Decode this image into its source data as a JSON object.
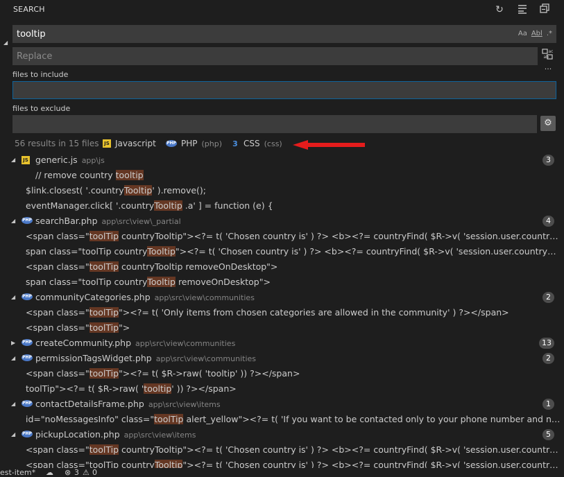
{
  "header": {
    "title": "SEARCH",
    "refresh_icon": "refresh-icon",
    "clear_icon": "clear-results-icon",
    "collapse_icon": "collapse-all-icon"
  },
  "search": {
    "query": "tooltip",
    "opt_case": "Aa",
    "opt_word": "Abl",
    "opt_regex": ".*",
    "replace_placeholder": "Replace",
    "include_label": "files to include",
    "include_value": "",
    "exclude_label": "files to exclude",
    "exclude_value": "",
    "more": "···"
  },
  "summary": {
    "text": "56 results in 15 files",
    "langs": [
      {
        "name": "Javascript",
        "sub": "",
        "badge": "JS"
      },
      {
        "name": "PHP",
        "sub": "(php)",
        "badge": "PHP"
      },
      {
        "name": "CSS",
        "sub": "(css)",
        "badge": "3"
      }
    ]
  },
  "colors": {
    "accent": "#0e639c",
    "highlight": "#653723",
    "arrow": "#e51c1c",
    "js": "#e8c22d",
    "php": "#4a78c7"
  },
  "results": [
    {
      "type": "file",
      "expanded": true,
      "icon": "js",
      "name": "generic.js",
      "path": "app\\js",
      "count": "3"
    },
    {
      "type": "match",
      "indent": 51,
      "pre": "// remove country ",
      "hl": "tooltip",
      "post": ""
    },
    {
      "type": "match",
      "indent": 37,
      "pre": "$link.closest( '.country",
      "hl": "Tooltip",
      "post": "' ).remove();"
    },
    {
      "type": "match",
      "indent": 37,
      "pre": "eventManager.click[ '.country",
      "hl": "Tooltip",
      "post": " .a' ] = function (e) {"
    },
    {
      "type": "file",
      "expanded": true,
      "icon": "php",
      "name": "searchBar.php",
      "path": "app\\src\\view\\_partial",
      "count": "4"
    },
    {
      "type": "match",
      "indent": 37,
      "pre": "<span class=\"",
      "hl": "toolTip",
      "post": " countryTooltip\"><?= t( 'Chosen country is' ) ?> <b><?= countryFind( $R->v( 'session.user.countryAddress', $R->v('sessio"
    },
    {
      "type": "match",
      "indent": 37,
      "pre": "span class=\"toolTip country",
      "hl": "Tooltip",
      "post": "\"><?= t( 'Chosen country is' ) ?> <b><?= countryFind( $R->v( 'session.user.countryAddress', $R->v('session."
    },
    {
      "type": "match",
      "indent": 37,
      "pre": "<span class=\"",
      "hl": "toolTip",
      "post": " countryTooltip removeOnDesktop\">"
    },
    {
      "type": "match",
      "indent": 37,
      "pre": "span class=\"toolTip country",
      "hl": "Tooltip",
      "post": " removeOnDesktop\">"
    },
    {
      "type": "file",
      "expanded": true,
      "icon": "php",
      "name": "communityCategories.php",
      "path": "app\\src\\view\\communities",
      "count": "2"
    },
    {
      "type": "match",
      "indent": 37,
      "pre": "<span class=\"",
      "hl": "toolTip",
      "post": "\"><?= t( 'Only items from chosen categories are allowed in the community' ) ?></span>"
    },
    {
      "type": "match",
      "indent": 37,
      "pre": "<span class=\"",
      "hl": "toolTip",
      "post": "\">"
    },
    {
      "type": "file",
      "expanded": false,
      "icon": "php",
      "name": "createCommunity.php",
      "path": "app\\src\\view\\communities",
      "count": "13"
    },
    {
      "type": "file",
      "expanded": true,
      "icon": "php",
      "name": "permissionTagsWidget.php",
      "path": "app\\src\\view\\communities",
      "count": "2"
    },
    {
      "type": "match",
      "indent": 37,
      "pre": "<span class=\"",
      "hl": "toolTip",
      "post": "\"><?= t( $R->raw( 'tooltip' )) ?></span>"
    },
    {
      "type": "match",
      "indent": 37,
      "pre": "toolTip\"><?= t( $R->raw( '",
      "hl": "tooltip",
      "post": "' )) ?></span>"
    },
    {
      "type": "file",
      "expanded": true,
      "icon": "php",
      "name": "contactDetailsFrame.php",
      "path": "app\\src\\view\\items",
      "count": "1"
    },
    {
      "type": "match",
      "indent": 37,
      "pre": "id=\"noMessagesInfo\" class=\"",
      "hl": "toolTip",
      "post": " alert_yellow\"><?= t( 'If you want to be contacted only to your phone number and not to the messages, plea"
    },
    {
      "type": "file",
      "expanded": true,
      "icon": "php",
      "name": "pickupLocation.php",
      "path": "app\\src\\view\\items",
      "count": "5"
    },
    {
      "type": "match",
      "indent": 37,
      "pre": "<span class=\"",
      "hl": "toolTip",
      "post": " countryTooltip\"><?= t( 'Chosen country is' ) ?> <b><?= countryFind( $R->v( 'session.user.countryAddress', $R->v('sessio"
    },
    {
      "type": "match",
      "indent": 37,
      "pre": "<span class=\"toolTip country",
      "hl": "Tooltip",
      "post": "\"><?= t( 'Chosen country is' ) ?> <b><?= countryFind( $R->v( 'session.user.countryAddress', $R->v('session."
    }
  ],
  "statusbar": {
    "branch": "est-item*",
    "sync_icon": "cloud-sync-icon",
    "errors": "3",
    "warnings": "0"
  }
}
